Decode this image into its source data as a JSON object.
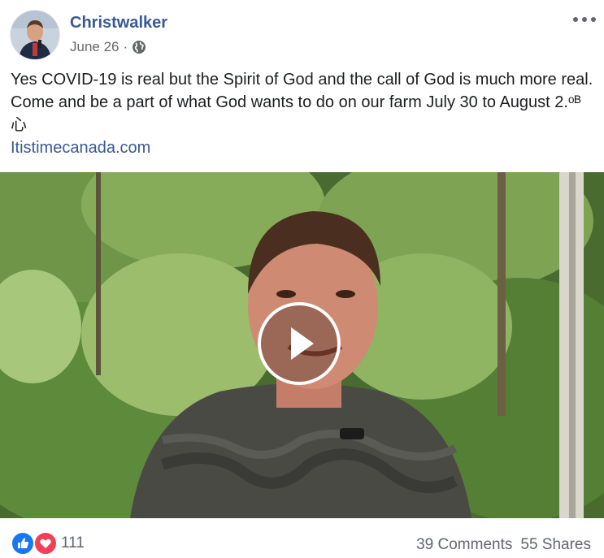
{
  "post": {
    "author": "Christwalker",
    "date": "June 26",
    "date_separator": "·",
    "privacy_icon": "globe-icon",
    "more_icon": "more-options-icon",
    "text": "Yes COVID-19 is real but the Spirit of God and the call of God is much more real. Come and be a part of what God wants to do on our farm July 30 to August 2.ᵒᴮ⼼",
    "link": "Itistimecanada.com"
  },
  "video": {
    "play_icon": "play-icon"
  },
  "footer": {
    "reaction_icons": [
      "like-icon",
      "love-icon"
    ],
    "reaction_count": "111",
    "comments": "39 Comments",
    "shares": "55 Shares"
  },
  "colors": {
    "link": "#385898",
    "like": "#1877f2",
    "love": "#f33e58",
    "muted": "#65676b"
  }
}
